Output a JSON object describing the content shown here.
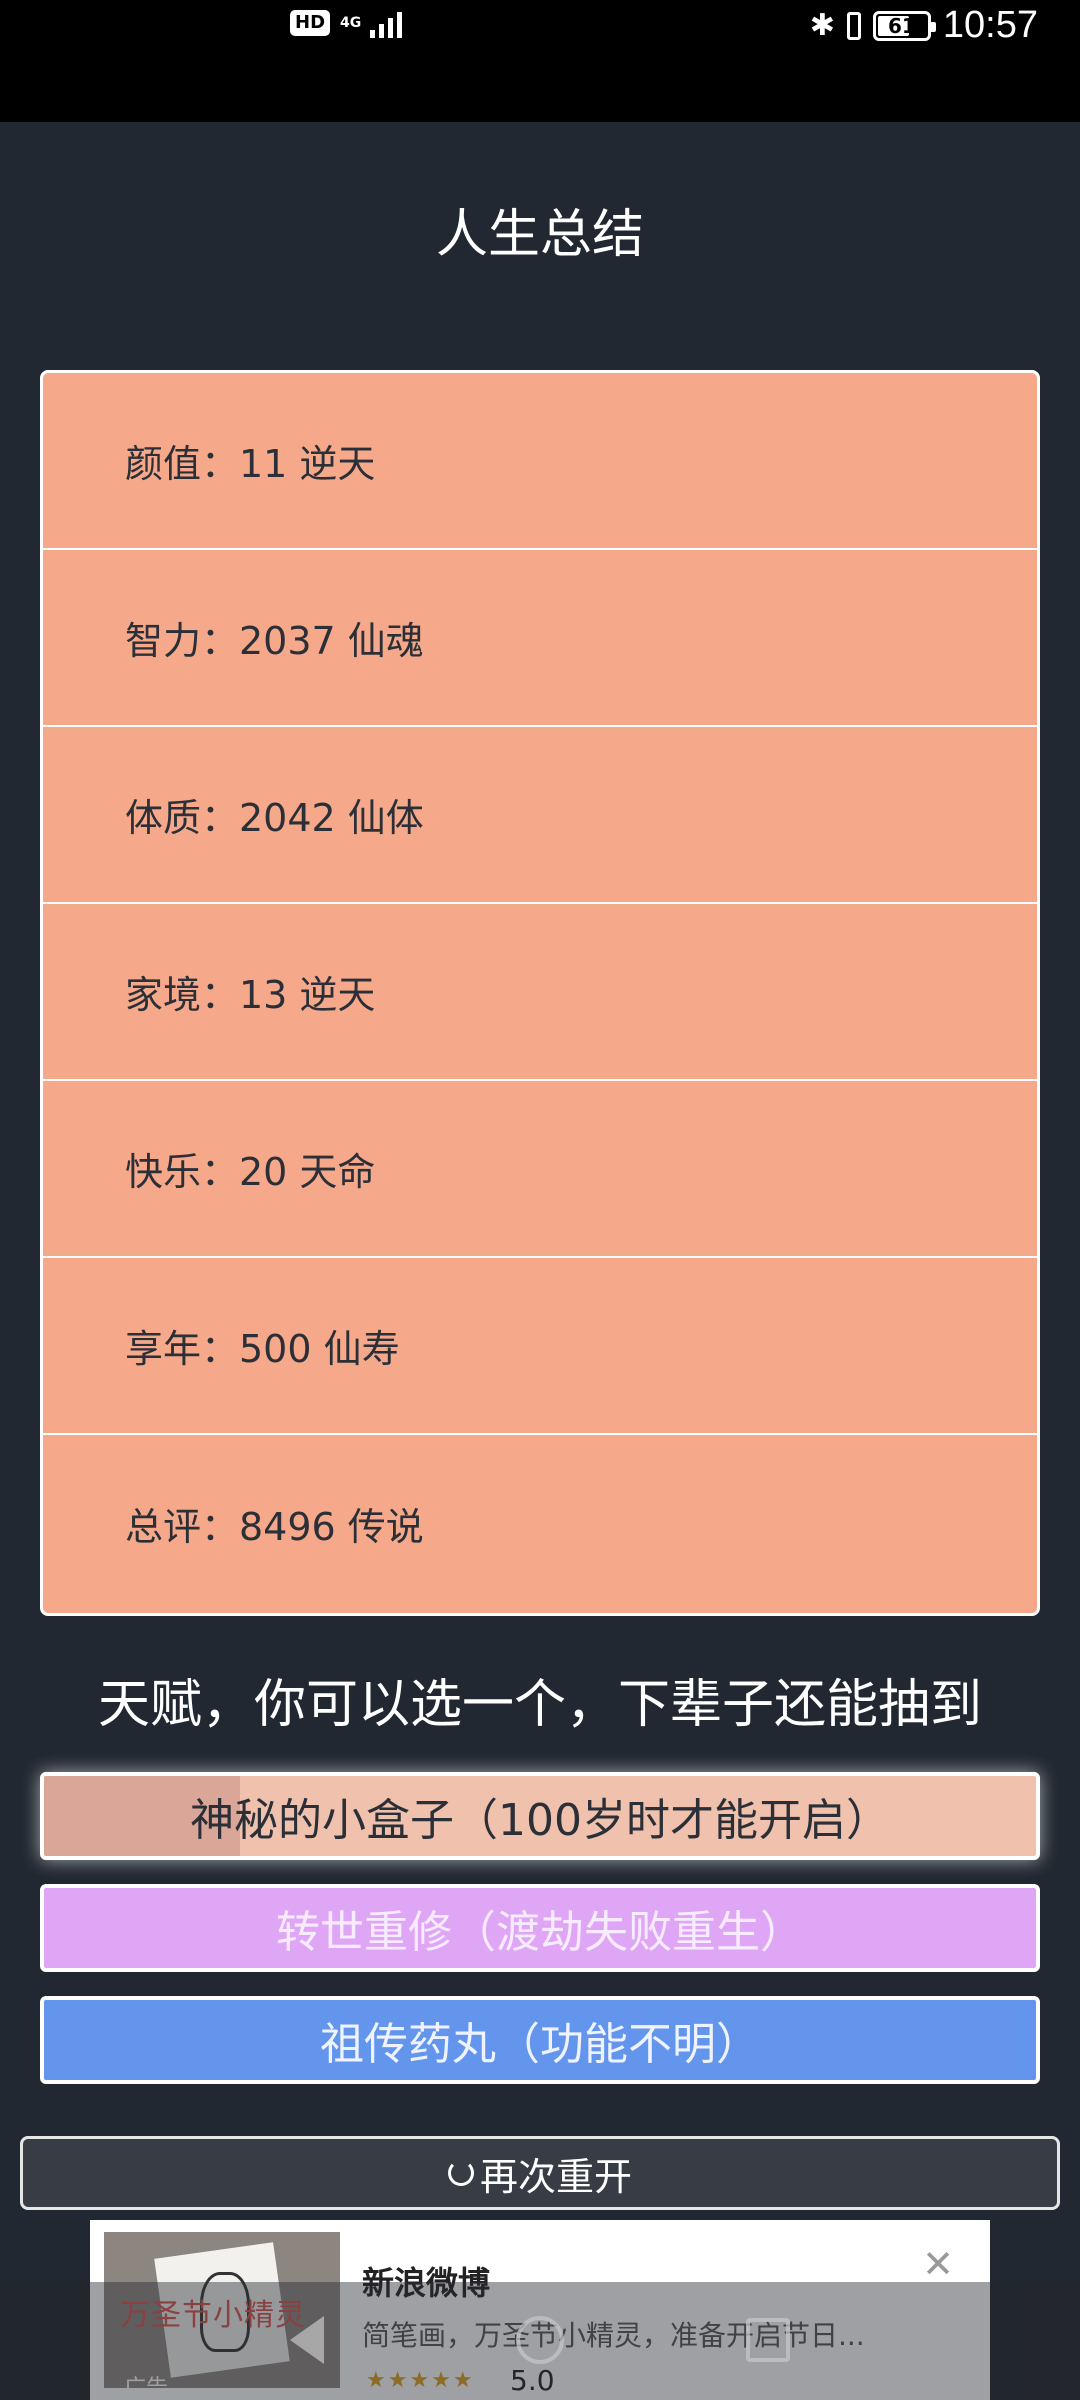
{
  "status_bar": {
    "hd": "HD",
    "network": "4G",
    "battery": "61",
    "time": "10:57"
  },
  "title": "人生总结",
  "stats": [
    {
      "label": "颜值：11 逆天"
    },
    {
      "label": "智力：2037 仙魂"
    },
    {
      "label": "体质：2042 仙体"
    },
    {
      "label": "家境：13 逆天"
    },
    {
      "label": "快乐：20 天命"
    },
    {
      "label": "享年：500 仙寿"
    },
    {
      "label": "总评：8496 传说"
    }
  ],
  "talent_prompt": "天赋，你可以选一个，下辈子还能抽到",
  "talents": [
    {
      "label": "神秘的小盒子（100岁时才能开启）",
      "color": "#f0c1ad"
    },
    {
      "label": "转世重修（渡劫失败重生）",
      "color": "#e0a6f6"
    },
    {
      "label": "祖传药丸（功能不明）",
      "color": "#6495ed"
    }
  ],
  "restart_label": "再次重开",
  "ad": {
    "thumb_text": "万圣节小精灵",
    "brand": "新浪微博",
    "desc": "简笔画，万圣节小精灵，准备开启节日...",
    "stars": "★★★★★",
    "rating": "5.0",
    "tag": "广告"
  },
  "colors": {
    "background": "#222831",
    "stats_panel": "#f6a98a"
  }
}
